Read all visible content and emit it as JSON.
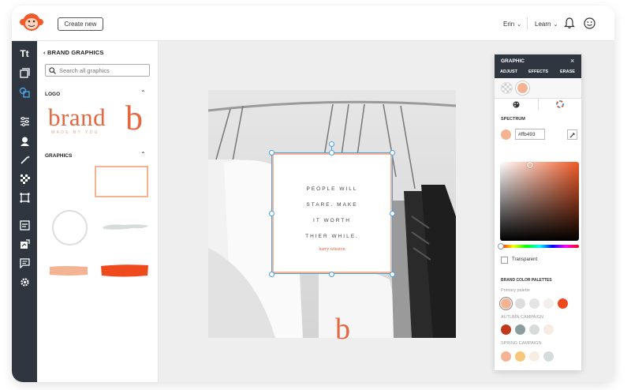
{
  "header": {
    "create_label": "Create new",
    "user_name": "Erin",
    "learn_label": "Learn"
  },
  "sidebar": {
    "title": "BRAND GRAPHICS",
    "search_placeholder": "Search all graphics",
    "logo_section": "LOGO",
    "graphics_section": "GRAPHICS",
    "logo_word": "brand",
    "logo_tagline": "MADE BY YOU",
    "logo_letter": "b"
  },
  "rail": {
    "items": [
      "text-icon",
      "photos-icon",
      "graphics-icon",
      "adjust-icon",
      "users-icon",
      "magic-icon",
      "texture-icon",
      "frame-icon",
      "designs-icon",
      "upload-icon",
      "comment-icon",
      "settings-icon"
    ]
  },
  "canvas": {
    "quote": "PEOPLE WILL STARE. MAKE IT WORTH THIER WHILE.",
    "quote_lines": [
      "PEOPLE WILL",
      "STARE. MAKE",
      "IT WORTH",
      "THIER WHILE."
    ],
    "author": "harry winston",
    "corner_letter": "b"
  },
  "graphic_panel": {
    "title": "GRAPHIC",
    "tabs": [
      "ADJUST",
      "EFFECTS",
      "ERASE"
    ],
    "spectrum_label": "SPECTRUM",
    "hex_value": "#ffb493",
    "transparent_label": "Transparent",
    "brand_palettes_label": "BRAND COLOR PALETTES",
    "palettes": [
      {
        "name": "Primary palette",
        "colors": [
          "#f4b494",
          "#dddddd",
          "#e4e4e4",
          "#f4efeb",
          "#ef4a1e"
        ],
        "selected": 0
      },
      {
        "name": "AUTUMN CAMPAIGN",
        "colors": [
          "#c0391b",
          "#8a9d9d",
          "#d5dcdb",
          "#f7ece3"
        ]
      },
      {
        "name": "SPRING CAMPAIGN",
        "colors": [
          "#f4b494",
          "#f6c87a",
          "#f6ede3",
          "#d5dcdb"
        ]
      }
    ]
  },
  "colors": {
    "accent": "#e8663d",
    "peach": "#f4b494",
    "rail_bg": "#2f3640",
    "selection": "#4aa3df"
  }
}
